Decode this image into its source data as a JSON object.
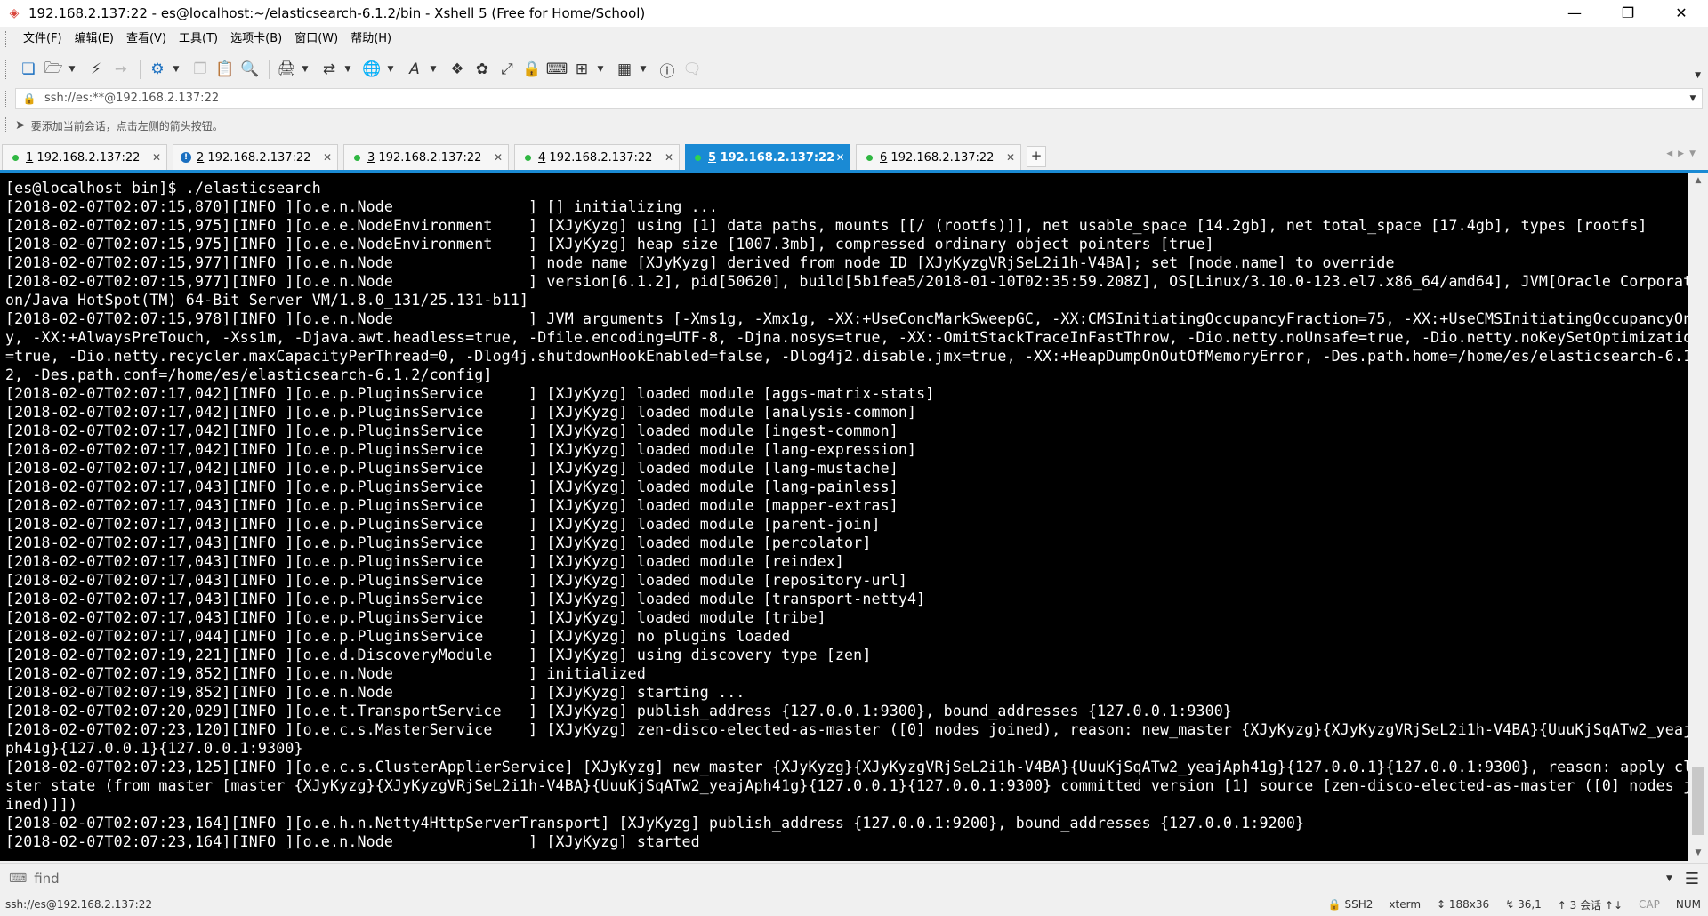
{
  "window": {
    "title": "192.168.2.137:22 - es@localhost:~/elasticsearch-6.1.2/bin - Xshell 5 (Free for Home/School)",
    "controls": {
      "minimize": "—",
      "maximize": "❐",
      "close": "✕"
    }
  },
  "menu": [
    "文件(F)",
    "编辑(E)",
    "查看(V)",
    "工具(T)",
    "选项卡(B)",
    "窗口(W)",
    "帮助(H)"
  ],
  "address": {
    "value": "ssh://es:**@192.168.2.137:22",
    "icon": "lock-icon"
  },
  "hint": {
    "text": "要添加当前会话，点击左侧的箭头按钮。",
    "icon": "arrow-pin-icon"
  },
  "tabs": [
    {
      "num": "1",
      "host": "192.168.2.137:22",
      "status": "connected",
      "active": false
    },
    {
      "num": "2",
      "host": "192.168.2.137:22",
      "status": "alert",
      "active": false
    },
    {
      "num": "3",
      "host": "192.168.2.137:22",
      "status": "connected",
      "active": false
    },
    {
      "num": "4",
      "host": "192.168.2.137:22",
      "status": "connected",
      "active": false
    },
    {
      "num": "5",
      "host": "192.168.2.137:22",
      "status": "connected",
      "active": true
    },
    {
      "num": "6",
      "host": "192.168.2.137:22",
      "status": "connected",
      "active": false
    }
  ],
  "terminal": {
    "lines": [
      "[es@localhost bin]$ ./elasticsearch",
      "[2018-02-07T02:07:15,870][INFO ][o.e.n.Node               ] [] initializing ...",
      "[2018-02-07T02:07:15,975][INFO ][o.e.e.NodeEnvironment    ] [XJyKyzg] using [1] data paths, mounts [[/ (rootfs)]], net usable_space [14.2gb], net total_space [17.4gb], types [rootfs]",
      "[2018-02-07T02:07:15,975][INFO ][o.e.e.NodeEnvironment    ] [XJyKyzg] heap size [1007.3mb], compressed ordinary object pointers [true]",
      "[2018-02-07T02:07:15,977][INFO ][o.e.n.Node               ] node name [XJyKyzg] derived from node ID [XJyKyzgVRjSeL2i1h-V4BA]; set [node.name] to override",
      "[2018-02-07T02:07:15,977][INFO ][o.e.n.Node               ] version[6.1.2], pid[50620], build[5b1fea5/2018-01-10T02:35:59.208Z], OS[Linux/3.10.0-123.el7.x86_64/amd64], JVM[Oracle Corporati",
      "on/Java HotSpot(TM) 64-Bit Server VM/1.8.0_131/25.131-b11]",
      "[2018-02-07T02:07:15,978][INFO ][o.e.n.Node               ] JVM arguments [-Xms1g, -Xmx1g, -XX:+UseConcMarkSweepGC, -XX:CMSInitiatingOccupancyFraction=75, -XX:+UseCMSInitiatingOccupancyOnl",
      "y, -XX:+AlwaysPreTouch, -Xss1m, -Djava.awt.headless=true, -Dfile.encoding=UTF-8, -Djna.nosys=true, -XX:-OmitStackTraceInFastThrow, -Dio.netty.noUnsafe=true, -Dio.netty.noKeySetOptimization",
      "=true, -Dio.netty.recycler.maxCapacityPerThread=0, -Dlog4j.shutdownHookEnabled=false, -Dlog4j2.disable.jmx=true, -XX:+HeapDumpOnOutOfMemoryError, -Des.path.home=/home/es/elasticsearch-6.1.",
      "2, -Des.path.conf=/home/es/elasticsearch-6.1.2/config]",
      "[2018-02-07T02:07:17,042][INFO ][o.e.p.PluginsService     ] [XJyKyzg] loaded module [aggs-matrix-stats]",
      "[2018-02-07T02:07:17,042][INFO ][o.e.p.PluginsService     ] [XJyKyzg] loaded module [analysis-common]",
      "[2018-02-07T02:07:17,042][INFO ][o.e.p.PluginsService     ] [XJyKyzg] loaded module [ingest-common]",
      "[2018-02-07T02:07:17,042][INFO ][o.e.p.PluginsService     ] [XJyKyzg] loaded module [lang-expression]",
      "[2018-02-07T02:07:17,042][INFO ][o.e.p.PluginsService     ] [XJyKyzg] loaded module [lang-mustache]",
      "[2018-02-07T02:07:17,043][INFO ][o.e.p.PluginsService     ] [XJyKyzg] loaded module [lang-painless]",
      "[2018-02-07T02:07:17,043][INFO ][o.e.p.PluginsService     ] [XJyKyzg] loaded module [mapper-extras]",
      "[2018-02-07T02:07:17,043][INFO ][o.e.p.PluginsService     ] [XJyKyzg] loaded module [parent-join]",
      "[2018-02-07T02:07:17,043][INFO ][o.e.p.PluginsService     ] [XJyKyzg] loaded module [percolator]",
      "[2018-02-07T02:07:17,043][INFO ][o.e.p.PluginsService     ] [XJyKyzg] loaded module [reindex]",
      "[2018-02-07T02:07:17,043][INFO ][o.e.p.PluginsService     ] [XJyKyzg] loaded module [repository-url]",
      "[2018-02-07T02:07:17,043][INFO ][o.e.p.PluginsService     ] [XJyKyzg] loaded module [transport-netty4]",
      "[2018-02-07T02:07:17,043][INFO ][o.e.p.PluginsService     ] [XJyKyzg] loaded module [tribe]",
      "[2018-02-07T02:07:17,044][INFO ][o.e.p.PluginsService     ] [XJyKyzg] no plugins loaded",
      "[2018-02-07T02:07:19,221][INFO ][o.e.d.DiscoveryModule    ] [XJyKyzg] using discovery type [zen]",
      "[2018-02-07T02:07:19,852][INFO ][o.e.n.Node               ] initialized",
      "[2018-02-07T02:07:19,852][INFO ][o.e.n.Node               ] [XJyKyzg] starting ...",
      "[2018-02-07T02:07:20,029][INFO ][o.e.t.TransportService   ] [XJyKyzg] publish_address {127.0.0.1:9300}, bound_addresses {127.0.0.1:9300}",
      "[2018-02-07T02:07:23,120][INFO ][o.e.c.s.MasterService    ] [XJyKyzg] zen-disco-elected-as-master ([0] nodes joined), reason: new_master {XJyKyzg}{XJyKyzgVRjSeL2i1h-V4BA}{UuuKjSqATw2_yeajA",
      "ph41g}{127.0.0.1}{127.0.0.1:9300}",
      "[2018-02-07T02:07:23,125][INFO ][o.e.c.s.ClusterApplierService] [XJyKyzg] new_master {XJyKyzg}{XJyKyzgVRjSeL2i1h-V4BA}{UuuKjSqATw2_yeajAph41g}{127.0.0.1}{127.0.0.1:9300}, reason: apply clu",
      "ster state (from master [master {XJyKyzg}{XJyKyzgVRjSeL2i1h-V4BA}{UuuKjSqATw2_yeajAph41g}{127.0.0.1}{127.0.0.1:9300} committed version [1] source [zen-disco-elected-as-master ([0] nodes jo",
      "ined)]])",
      "[2018-02-07T02:07:23,164][INFO ][o.e.h.n.Netty4HttpServerTransport] [XJyKyzg] publish_address {127.0.0.1:9200}, bound_addresses {127.0.0.1:9200}",
      "[2018-02-07T02:07:23,164][INFO ][o.e.n.Node               ] [XJyKyzg] started"
    ]
  },
  "find": {
    "placeholder": "find"
  },
  "status": {
    "connection": "ssh://es@192.168.2.137:22",
    "protocol": "SSH2",
    "terminal_type": "xterm",
    "size": "188x36",
    "cursor": "36,1",
    "sessions": "3 会话",
    "caps": "CAP",
    "num": "NUM"
  },
  "colors": {
    "accent": "#1a8ad4",
    "terminal_bg": "#000000",
    "terminal_fg": "#ffffff",
    "connected": "#2fb742"
  }
}
